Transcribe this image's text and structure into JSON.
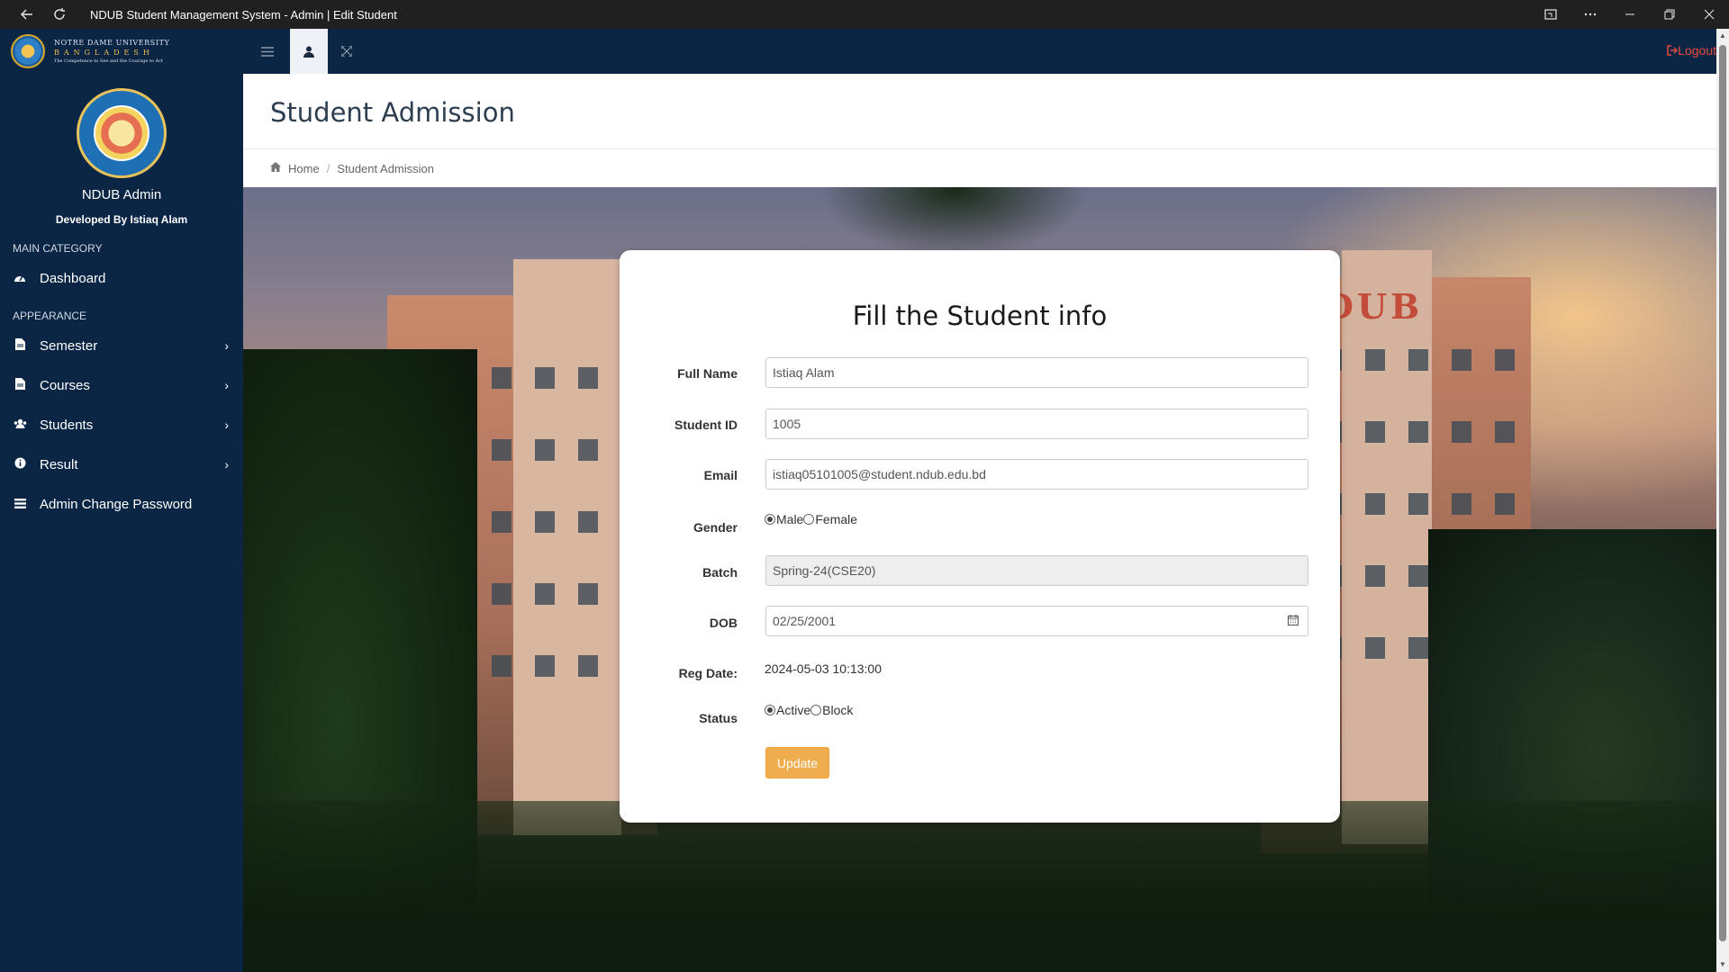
{
  "window": {
    "title": "NDUB Student Management System - Admin | Edit Student",
    "icons": [
      "back-icon",
      "reload-icon",
      "cast-icon",
      "more-icon",
      "minimize-icon",
      "restore-icon",
      "close-icon"
    ]
  },
  "brand": {
    "line1": "NOTRE DAME UNIVERSITY",
    "line2": "BANGLADESH",
    "line3": "The Competence to See and the Courage to Act"
  },
  "sidebar": {
    "admin_name": "NDUB Admin",
    "developer": "Developed By Istiaq Alam",
    "main_heading": "MAIN CATEGORY",
    "appearance_heading": "APPEARANCE",
    "items": [
      {
        "label": "Dashboard",
        "icon": "dashboard-icon"
      },
      {
        "label": "Semester",
        "icon": "file-icon"
      },
      {
        "label": "Courses",
        "icon": "file-icon"
      },
      {
        "label": "Students",
        "icon": "users-icon"
      },
      {
        "label": "Result",
        "icon": "info-icon"
      },
      {
        "label": "Admin Change Password",
        "icon": "list-icon"
      }
    ]
  },
  "topnav": {
    "logout_label": "Logout",
    "icons": [
      "menu-toggle-icon",
      "user-icon",
      "fullscreen-icon",
      "logout-icon"
    ]
  },
  "header": {
    "title": "Student Admission"
  },
  "breadcrumb": {
    "home": "Home",
    "current": "Student Admission"
  },
  "background": {
    "sign_text": "DUB"
  },
  "form": {
    "title": "Fill the Student info",
    "full_name_label": "Full Name",
    "full_name_value": "Istiaq Alam",
    "student_id_label": "Student ID",
    "student_id_value": "1005",
    "email_label": "Email",
    "email_value": "istiaq05101005@student.ndub.edu.bd",
    "gender_label": "Gender",
    "gender_male": "Male",
    "gender_female": "Female",
    "gender_selected": "Male",
    "batch_label": "Batch",
    "batch_value": "Spring-24(CSE20)",
    "dob_label": "DOB",
    "dob_value": "02/25/2001",
    "reg_date_label": "Reg Date:",
    "reg_date_value": "2024-05-03 10:13:00",
    "status_label": "Status",
    "status_active": "Active",
    "status_block": "Block",
    "status_selected": "Active",
    "update_label": "Update"
  },
  "colors": {
    "sidebar_bg": "#0b2545",
    "update_button": "#f0ad4e",
    "logout": "#e74c3c"
  }
}
